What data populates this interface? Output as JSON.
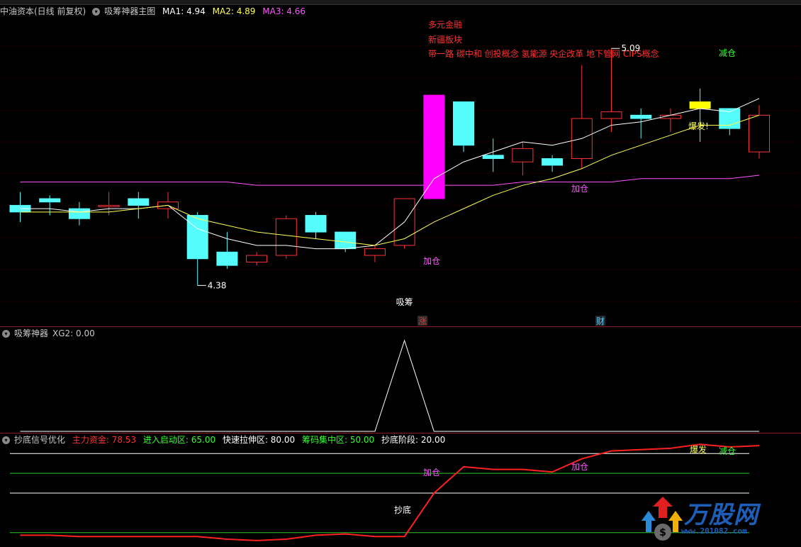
{
  "main_header": {
    "stock": "中油资本(日线 前复权)",
    "indicator": "吸筹神器主图",
    "ma1_label": "MA1: 4.94",
    "ma2_label": "MA2: 4.89",
    "ma3_label": "MA3: 4.66"
  },
  "sub1_header": {
    "indicator": "吸筹神器",
    "xg2_label": "XG2: 0.00"
  },
  "sub2_header": {
    "indicator": "抄底信号优化",
    "items": [
      "主力资金: 78.53",
      "进入启动区: 65.00",
      "快速拉伸区: 80.00",
      "筹码集中区: 50.00",
      "抄底阶段: 20.00"
    ]
  },
  "annotations": {
    "concepts": [
      "多元金融",
      "新疆板块",
      "带一路 碳中和 创投概念 氢能源 央企改革 地下管网 CIPS概念"
    ],
    "high": "5.09",
    "low": "4.38",
    "xichou": "吸筹",
    "jiacang1": "加仓",
    "jiacang2": "加仓",
    "jiancang": "减仓",
    "baofa": "爆发!",
    "zhang": "涨",
    "cai": "财",
    "sub2_chaodi": "抄底",
    "sub2_jiacang1": "加仓",
    "sub2_jiacang2": "加仓",
    "sub2_jiancang": "减仓",
    "sub2_baofa": "爆发"
  },
  "logo": {
    "text": "万股网",
    "url": "www.201082.com"
  },
  "colors": {
    "up": "#ff3232",
    "down": "#54fcfc",
    "ma1": "#ffffff",
    "ma2": "#ffff54",
    "ma3": "#ff54ff",
    "highlight": "#ffff00"
  },
  "chart_data": [
    {
      "type": "candlestick",
      "title": "中油资本(日线 前复权)",
      "ylim": [
        4.3,
        5.15
      ],
      "candles": [
        {
          "o": 4.62,
          "h": 4.66,
          "l": 4.57,
          "c": 4.6
        },
        {
          "o": 4.64,
          "h": 4.65,
          "l": 4.59,
          "c": 4.63
        },
        {
          "o": 4.61,
          "h": 4.63,
          "l": 4.56,
          "c": 4.58
        },
        {
          "o": 4.62,
          "h": 4.66,
          "l": 4.59,
          "c": 4.62
        },
        {
          "o": 4.64,
          "h": 4.66,
          "l": 4.58,
          "c": 4.62
        },
        {
          "o": 4.61,
          "h": 4.66,
          "l": 4.58,
          "c": 4.63
        },
        {
          "o": 4.59,
          "h": 4.6,
          "l": 4.38,
          "c": 4.46
        },
        {
          "o": 4.48,
          "h": 4.54,
          "l": 4.43,
          "c": 4.44
        },
        {
          "o": 4.45,
          "h": 4.48,
          "l": 4.44,
          "c": 4.47
        },
        {
          "o": 4.47,
          "h": 4.59,
          "l": 4.46,
          "c": 4.58
        },
        {
          "o": 4.59,
          "h": 4.6,
          "l": 4.52,
          "c": 4.54
        },
        {
          "o": 4.54,
          "h": 4.54,
          "l": 4.48,
          "c": 4.49
        },
        {
          "o": 4.47,
          "h": 4.5,
          "l": 4.45,
          "c": 4.49
        },
        {
          "o": 4.5,
          "h": 4.64,
          "l": 4.49,
          "c": 4.64
        },
        {
          "o": 4.64,
          "h": 4.95,
          "l": 4.64,
          "c": 4.95
        },
        {
          "o": 4.93,
          "h": 4.93,
          "l": 4.78,
          "c": 4.8
        },
        {
          "o": 4.77,
          "h": 4.82,
          "l": 4.72,
          "c": 4.76
        },
        {
          "o": 4.75,
          "h": 4.81,
          "l": 4.71,
          "c": 4.79
        },
        {
          "o": 4.76,
          "h": 4.77,
          "l": 4.72,
          "c": 4.74
        },
        {
          "o": 4.76,
          "h": 5.04,
          "l": 4.73,
          "c": 4.88
        },
        {
          "o": 4.88,
          "h": 5.09,
          "l": 4.84,
          "c": 4.9
        },
        {
          "o": 4.89,
          "h": 4.91,
          "l": 4.82,
          "c": 4.88
        },
        {
          "o": 4.88,
          "h": 4.91,
          "l": 4.84,
          "c": 4.89
        },
        {
          "o": 4.93,
          "h": 4.97,
          "l": 4.81,
          "c": 4.91
        },
        {
          "o": 4.91,
          "h": 4.91,
          "l": 4.83,
          "c": 4.85
        },
        {
          "o": 4.78,
          "h": 4.92,
          "l": 4.76,
          "c": 4.89
        }
      ],
      "series": [
        {
          "name": "MA1",
          "values": [
            4.61,
            4.61,
            4.6,
            4.61,
            4.61,
            4.62,
            4.55,
            4.52,
            4.5,
            4.5,
            4.49,
            4.49,
            4.5,
            4.57,
            4.7,
            4.75,
            4.78,
            4.81,
            4.8,
            4.82,
            4.86,
            4.87,
            4.89,
            4.91,
            4.9,
            4.94
          ]
        },
        {
          "name": "MA2",
          "values": [
            4.6,
            4.6,
            4.6,
            4.6,
            4.61,
            4.62,
            4.58,
            4.56,
            4.54,
            4.53,
            4.52,
            4.51,
            4.5,
            4.52,
            4.57,
            4.61,
            4.65,
            4.68,
            4.7,
            4.73,
            4.77,
            4.8,
            4.83,
            4.86,
            4.86,
            4.89
          ]
        },
        {
          "name": "MA3",
          "values": [
            4.69,
            4.69,
            4.69,
            4.69,
            4.69,
            4.69,
            4.69,
            4.69,
            4.68,
            4.68,
            4.68,
            4.68,
            4.68,
            4.68,
            4.68,
            4.68,
            4.68,
            4.69,
            4.69,
            4.69,
            4.69,
            4.7,
            4.7,
            4.7,
            4.7,
            4.71
          ]
        }
      ]
    },
    {
      "type": "line",
      "title": "吸筹神器",
      "series": [
        {
          "name": "XG2",
          "values": [
            0,
            0,
            0,
            0,
            0,
            0,
            0,
            0,
            0,
            0,
            0,
            0,
            0,
            1,
            0,
            0,
            0,
            0,
            0,
            0,
            0,
            0,
            0,
            0,
            0,
            0
          ]
        }
      ],
      "ylim": [
        0,
        1
      ]
    },
    {
      "type": "line",
      "title": "抄底信号优化",
      "ylim": [
        15,
        85
      ],
      "series": [
        {
          "name": "主力资金",
          "values": [
            18,
            18,
            17,
            17,
            17,
            17,
            17,
            15,
            14,
            15,
            18,
            19,
            17,
            17,
            50,
            70,
            68,
            68,
            66,
            76,
            82,
            83,
            84,
            87,
            85,
            86
          ]
        },
        {
          "name": "进入启动区",
          "values": [
            65
          ]
        },
        {
          "name": "快速拉伸区",
          "values": [
            80
          ]
        },
        {
          "name": "筹码集中区",
          "values": [
            50
          ]
        },
        {
          "name": "抄底阶段",
          "values": [
            20
          ]
        }
      ]
    }
  ]
}
